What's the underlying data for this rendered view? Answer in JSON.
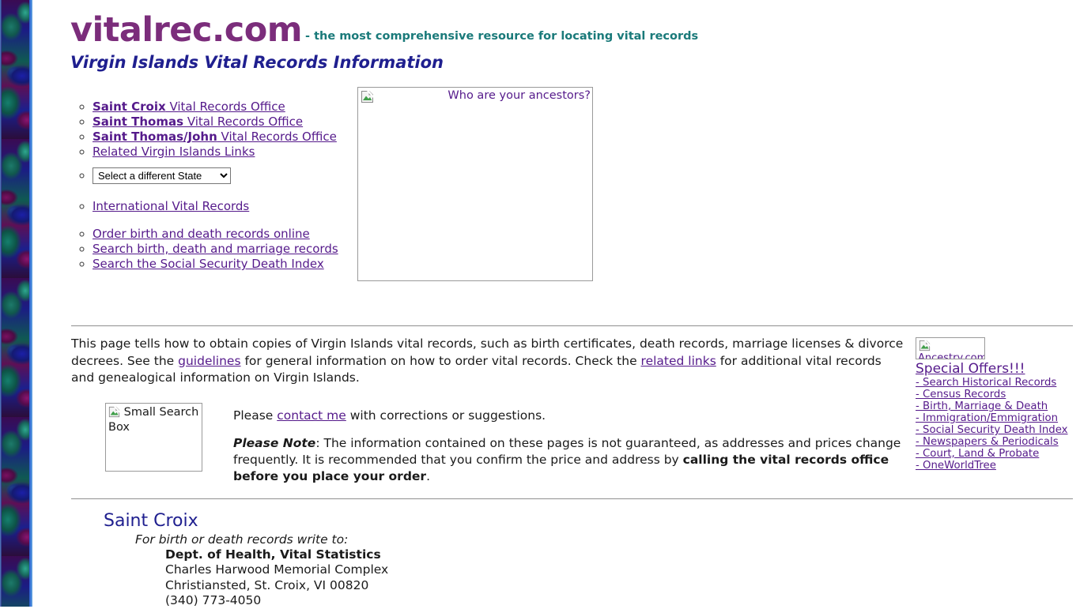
{
  "left_border": {
    "icon": "marble-border-tile"
  },
  "header": {
    "site_title": "vitalrec.com",
    "tagline": "- the most comprehensive resource for locating vital records",
    "subtitle": "Virgin Islands Vital Records Information",
    "brand_color": "#7b2d7b",
    "tagline_color": "#1a7a7a",
    "subtitle_color": "#1f1f8f"
  },
  "nav": {
    "items": [
      {
        "bold": "Saint Croix",
        "rest": " Vital Records Office"
      },
      {
        "bold": "Saint Thomas",
        "rest": " Vital Records Office"
      },
      {
        "bold": "Saint Thomas/John",
        "rest": " Vital Records Office"
      },
      {
        "bold": "",
        "rest": "Related Virgin Islands Links"
      }
    ],
    "state_select": {
      "selected": "Select a different State",
      "options": [
        "Select a different State"
      ]
    },
    "international": "International Vital Records",
    "order_links": [
      "Order birth and death records online",
      "Search birth, death and marriage records",
      "Search the Social Security Death Index"
    ]
  },
  "ancestors_image": {
    "alt": "Who are your ancestors?",
    "icon": "broken-image-icon"
  },
  "main": {
    "p1_a": "This page tells how to obtain copies of Virgin Islands vital records, such as birth certificates, death records, marriage licenses & divorce decrees. See the ",
    "p1_link1": "guidelines",
    "p1_b": " for general information on how to order vital records. Check the ",
    "p1_link2": "related links",
    "p1_c": " for additional vital records and genealogical information on Virgin Islands.",
    "search_box_alt": "Small Search Box",
    "contact_a": "Please ",
    "contact_link": "contact me",
    "contact_b": " with corrections or suggestions.",
    "note_label": "Please Note",
    "note_a": ": The information contained on these pages is not guaranteed, as addresses and prices change frequently. It is recommended that you confirm the price and address by ",
    "note_bold": "calling the vital records office before you place your order",
    "note_b": "."
  },
  "ancestry": {
    "image_alt": "Ancestry.com",
    "image_icon": "broken-image-icon",
    "headline": "Special Offers!!!",
    "links": [
      "- Search Historical Records",
      "- Census Records",
      "- Birth, Marriage & Death",
      "- Immigration/Emmigration",
      "- Social Security Death Index",
      "- Newspapers & Periodicals",
      "- Court, Land & Probate",
      "- OneWorldTree"
    ]
  },
  "saint_croix": {
    "heading": "Saint Croix",
    "intro": "For birth or death records write to:",
    "org": "Dept. of Health, Vital Statistics",
    "address_line1": "Charles Harwood Memorial Complex",
    "address_line2": "Christiansted, St. Croix, VI 00820",
    "phone": "(340) 773-4050"
  }
}
